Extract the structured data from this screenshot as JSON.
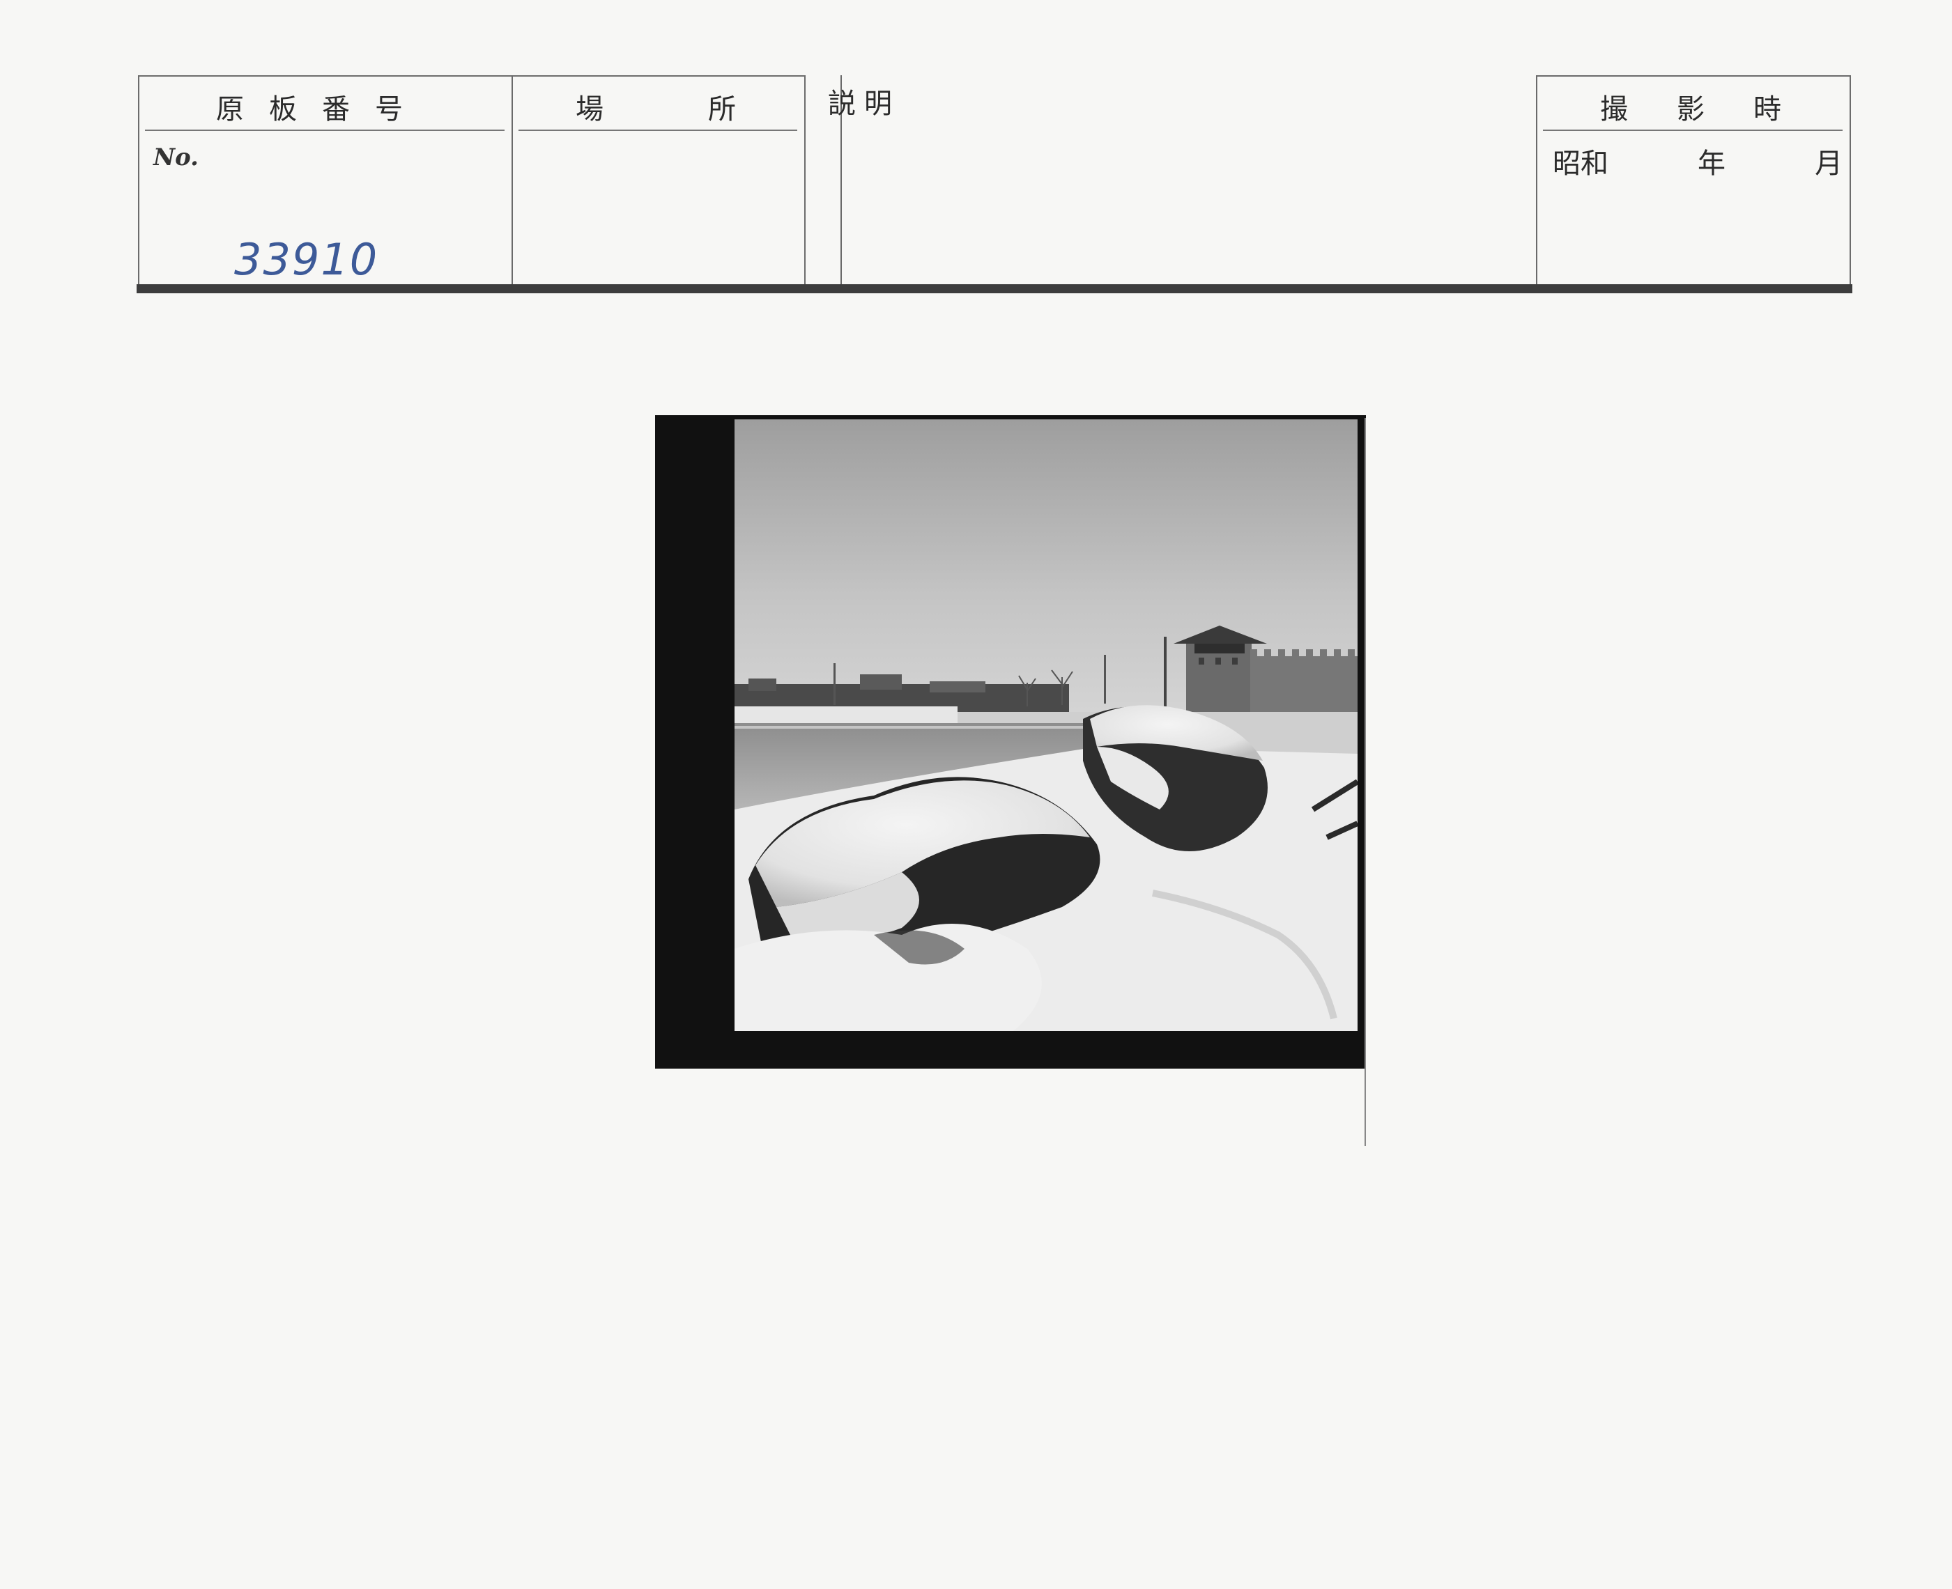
{
  "form": {
    "plate_number_header": "原板番号",
    "location_header": "場所",
    "description_header": "説明",
    "date_header": "撮影時",
    "no_label": "No.",
    "plate_number_value": "33910",
    "era": "昭和",
    "year_label": "年",
    "month_label": "月"
  },
  "photo": {
    "subject": "snow-covered-landscape-with-city-gate-tower"
  },
  "colors": {
    "paper": "#f7f7f5",
    "ink": "#2b2b2b",
    "handwriting_blue": "#3d5a98",
    "photo_border": "#111111"
  }
}
